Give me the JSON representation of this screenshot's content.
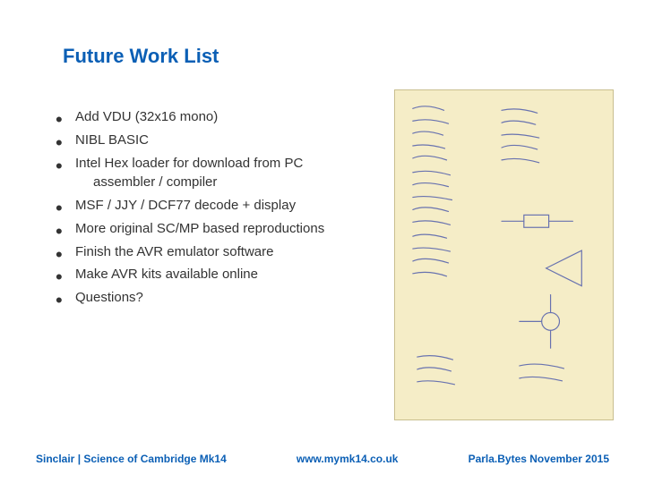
{
  "slide": {
    "title": "Future Work List",
    "bullets": [
      {
        "text": "Add VDU (32x16 mono)"
      },
      {
        "text": "NIBL BASIC"
      },
      {
        "text": "Intel Hex loader for download from PC",
        "sub": "assembler / compiler"
      },
      {
        "text": "MSF / JJY / DCF77 decode + display"
      },
      {
        "text": "More original SC/MP based reproductions"
      },
      {
        "text": "Finish the AVR emulator software"
      },
      {
        "text": "Make AVR kits available online"
      }
    ],
    "question": "Questions?",
    "image_name": "handwritten-notes-sketch"
  },
  "footer": {
    "left": "Sinclair | Science of Cambridge Mk14",
    "center": "www.mymk14.co.uk",
    "right": "Parla.Bytes November 2015"
  }
}
